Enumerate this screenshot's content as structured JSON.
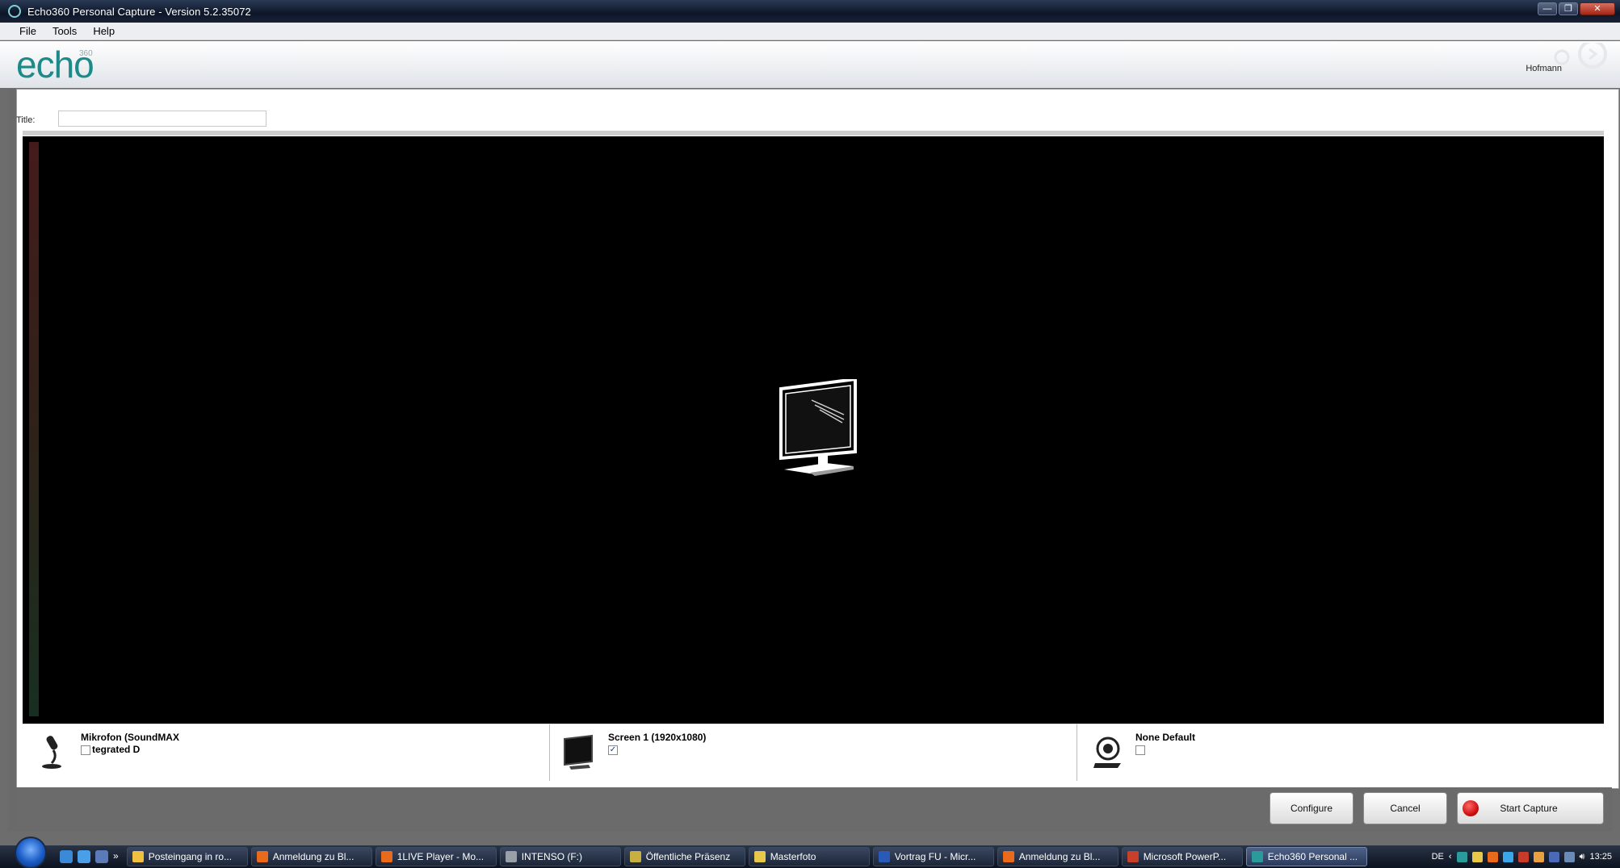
{
  "window": {
    "title": "Echo360 Personal Capture - Version 5.2.35072",
    "controls": [
      "—",
      "❐",
      "✕"
    ]
  },
  "menu": [
    "File",
    "Tools",
    "Help"
  ],
  "brand": {
    "logo_text": "echo",
    "logo_super": "360"
  },
  "user": {
    "name": "Hofmann"
  },
  "form": {
    "title_label": "Title:",
    "title_value": ""
  },
  "devices": [
    {
      "label": "Mikrofon (SoundMAX",
      "label2": "tegrated D",
      "checked": false,
      "icon": "microphone-icon"
    },
    {
      "label": "Screen 1 (1920x1080)",
      "checked": true,
      "icon": "screen-icon"
    },
    {
      "label": "None Default",
      "checked": false,
      "icon": "webcam-icon"
    }
  ],
  "buttons": {
    "configure": "Configure",
    "cancel": "Cancel",
    "start": "Start Capture"
  },
  "taskbar": {
    "items": [
      {
        "label": "Posteingang in ro...",
        "color": "#f0c040"
      },
      {
        "label": "Anmeldung zu Bl...",
        "color": "#e86a1a"
      },
      {
        "label": "1LIVE Player - Mo...",
        "color": "#e86a1a"
      },
      {
        "label": "INTENSO (F:)",
        "color": "#9aa0a8"
      },
      {
        "label": "Öffentliche Präsenz",
        "color": "#c8b040"
      },
      {
        "label": "Masterfoto",
        "color": "#e8c84a"
      },
      {
        "label": "Vortrag FU - Micr...",
        "color": "#2a5ab8"
      },
      {
        "label": "Anmeldung zu Bl...",
        "color": "#e86a1a"
      },
      {
        "label": "Microsoft PowerP...",
        "color": "#c8402a"
      },
      {
        "label": "Echo360 Personal ...",
        "color": "#2a9a9a",
        "active": true
      }
    ],
    "lang": "DE",
    "time": "13:25",
    "quicklaunch_more": "»"
  }
}
